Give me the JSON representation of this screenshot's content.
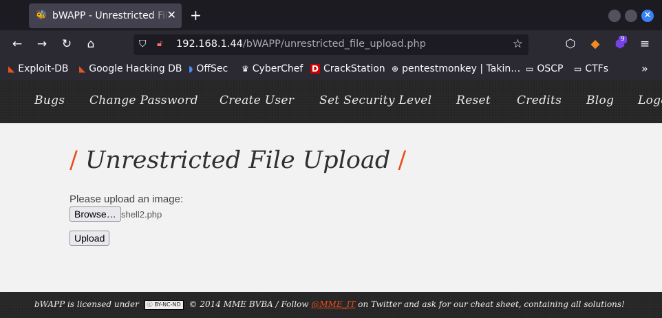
{
  "browser": {
    "tab_title": "bWAPP - Unrestricted File Upload",
    "url_host": "192.168.1.44",
    "url_path": "/bWAPP/unrestricted_file_upload.php",
    "extension_badge": "9",
    "bookmarks": [
      {
        "label": "Exploit-DB",
        "icon": "exploitdb-icon"
      },
      {
        "label": "Google Hacking DB",
        "icon": "ghdb-icon"
      },
      {
        "label": "OffSec",
        "icon": "offsec-icon"
      },
      {
        "label": "CyberChef",
        "icon": "cyberchef-icon"
      },
      {
        "label": "CrackStation",
        "icon": "crackstation-icon"
      },
      {
        "label": "pentestmonkey | Takin…",
        "icon": "globe-icon"
      },
      {
        "label": "OSCP",
        "icon": "folder-icon"
      },
      {
        "label": "CTFs",
        "icon": "folder-icon"
      }
    ]
  },
  "menu": [
    "Bugs",
    "Change Password",
    "Create User",
    "Set Security Level",
    "Reset",
    "Credits",
    "Blog",
    "Logout"
  ],
  "content": {
    "heading": "Unrestricted File Upload",
    "slash": "/",
    "prompt": "Please upload an image:",
    "browse_label": "Browse…",
    "file_name": "shell2.php",
    "upload_label": "Upload"
  },
  "footer": {
    "prefix": "bWAPP is licensed under",
    "license_badge": "BY-NC-ND",
    "middle": "© 2014 MME BVBA / Follow",
    "twitter": "@MME_IT",
    "suffix": "on Twitter and ask for our cheat sheet, containing all solutions!"
  },
  "colors": {
    "accent": "#e94d1a",
    "browser_bg": "#1c1b22",
    "toolbar_bg": "#2b2a33",
    "site_dark": "#262626"
  }
}
